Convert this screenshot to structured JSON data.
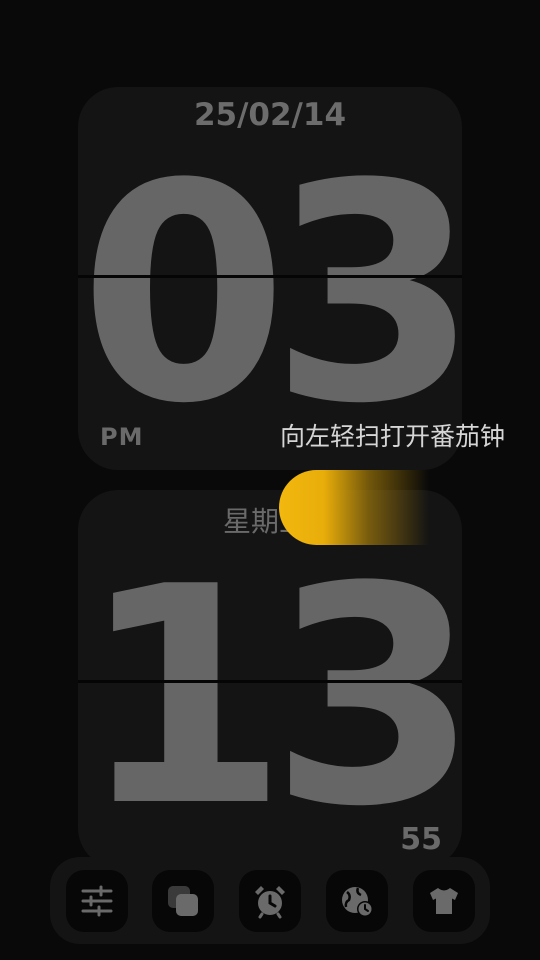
{
  "clock": {
    "date": "25/02/14",
    "hours": "03",
    "ampm": "PM",
    "weekday": "星期五",
    "minutes": "13",
    "seconds": "55"
  },
  "hint": "向左轻扫打开番茄钟",
  "accent_color": "#F2B80E",
  "toolbar": {
    "buttons": [
      {
        "icon": "sliders-icon"
      },
      {
        "icon": "layers-icon"
      },
      {
        "icon": "alarm-clock-icon"
      },
      {
        "icon": "world-clock-icon"
      },
      {
        "icon": "tshirt-icon"
      }
    ]
  }
}
